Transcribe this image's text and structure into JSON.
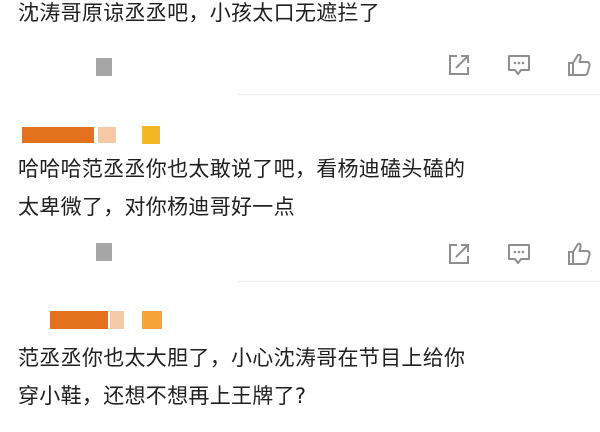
{
  "colors": {
    "text": "#1f1f1f",
    "icon": "#8f8f8f",
    "meta_placeholder": "#a6a6a6",
    "name_bar_primary": "#e3711e",
    "name_bar_faded": "#f6c9a6",
    "name_bar_accent": "#f5b623",
    "divider": "#ececec"
  },
  "comments": [
    {
      "text_lines": [
        "沈涛哥原谅丞丞吧，小孩太口无遮拦了"
      ],
      "actions": {
        "share_icon": "share-icon",
        "reply_icon": "comment-icon",
        "like_icon": "thumbs-up-icon"
      }
    },
    {
      "text_lines": [
        "哈哈哈范丞丞你也太敢说了吧，看杨迪磕头磕的",
        "太卑微了，对你杨迪哥好一点"
      ],
      "actions": {
        "share_icon": "share-icon",
        "reply_icon": "comment-icon",
        "like_icon": "thumbs-up-icon"
      }
    },
    {
      "text_lines": [
        "范丞丞你也太大胆了，小心沈涛哥在节目上给你",
        "穿小鞋，还想不想再上王牌了?"
      ]
    }
  ]
}
